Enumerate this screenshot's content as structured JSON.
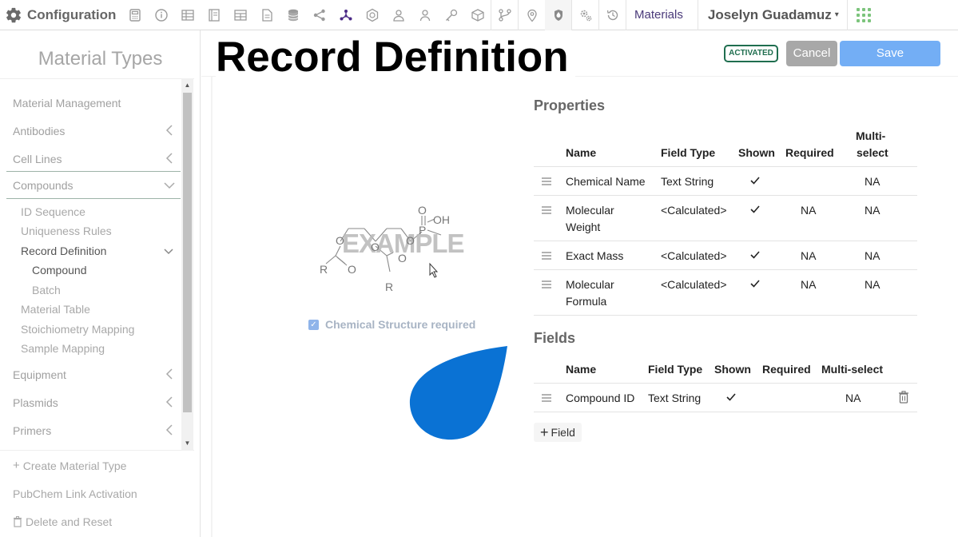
{
  "app": {
    "title": "Configuration",
    "materials_link": "Materials",
    "user_name": "Joselyn Guadamuz",
    "icons": [
      "calculator-icon",
      "info-icon",
      "table-icon",
      "notebook-icon",
      "grid-table-icon",
      "document-icon",
      "database-icon",
      "share-icon",
      "molecule-icon",
      "hexagon-icon",
      "users-icon",
      "user-icon",
      "key-icon",
      "box-icon",
      "branch-icon",
      "location-pin-icon",
      "drop-shield-icon",
      "settings-gears-icon",
      "history-icon"
    ]
  },
  "sidebar": {
    "title": "Material Types",
    "items": [
      {
        "label": "Material Management"
      },
      {
        "label": "Antibodies"
      },
      {
        "label": "Cell Lines"
      },
      {
        "label": "Compounds"
      },
      {
        "label": "Equipment"
      },
      {
        "label": "Plasmids"
      },
      {
        "label": "Primers"
      }
    ],
    "compound_children": [
      {
        "label": "ID Sequence"
      },
      {
        "label": "Uniqueness Rules"
      },
      {
        "label": "Record Definition"
      },
      {
        "label": "Material Table"
      },
      {
        "label": "Stoichiometry Mapping"
      },
      {
        "label": "Sample Mapping"
      }
    ],
    "record_children": [
      {
        "label": "Compound"
      },
      {
        "label": "Batch"
      }
    ],
    "actions": {
      "create": "Create Material Type",
      "pubchem": "PubChem Link Activation",
      "delete": "Delete and Reset"
    }
  },
  "main": {
    "title": "Record Definition",
    "status": "ACTIVATED",
    "cancel_label": "Cancel",
    "save_label": "Save",
    "structure": {
      "watermark": "EXAMPLE",
      "checkbox_label": "Chemical Structure required",
      "checkbox_checked": true,
      "atoms": {
        "r": "R",
        "o": "O",
        "p": "P",
        "oh": "OH"
      }
    },
    "properties": {
      "title": "Properties",
      "headers": {
        "name": "Name",
        "field_type": "Field Type",
        "shown": "Shown",
        "required": "Required",
        "multi_1": "Multi-",
        "multi_2": "select"
      },
      "rows": [
        {
          "name_1": "Chemical Name",
          "name_2": "",
          "type": "Text String",
          "shown": true,
          "required": "",
          "multi": "NA"
        },
        {
          "name_1": "Molecular",
          "name_2": "Weight",
          "type": "<Calculated>",
          "shown": true,
          "required": "NA",
          "multi": "NA"
        },
        {
          "name_1": "Exact Mass",
          "name_2": "",
          "type": "<Calculated>",
          "shown": true,
          "required": "NA",
          "multi": "NA"
        },
        {
          "name_1": "Molecular",
          "name_2": "Formula",
          "type": "<Calculated>",
          "shown": true,
          "required": "NA",
          "multi": "NA"
        }
      ]
    },
    "fields": {
      "title": "Fields",
      "headers": {
        "name": "Name",
        "field_type": "Field Type",
        "shown": "Shown",
        "required": "Required",
        "multi": "Multi-select"
      },
      "rows": [
        {
          "name": "Compound ID",
          "type": "Text String",
          "shown": true,
          "required": "",
          "multi": "NA"
        }
      ],
      "add_label": "Field"
    }
  },
  "colors": {
    "accent": "#73aef5",
    "status_green": "#1f6e4f",
    "blob_blue": "#0a72d4",
    "brand_purple": "#4b2a86"
  }
}
